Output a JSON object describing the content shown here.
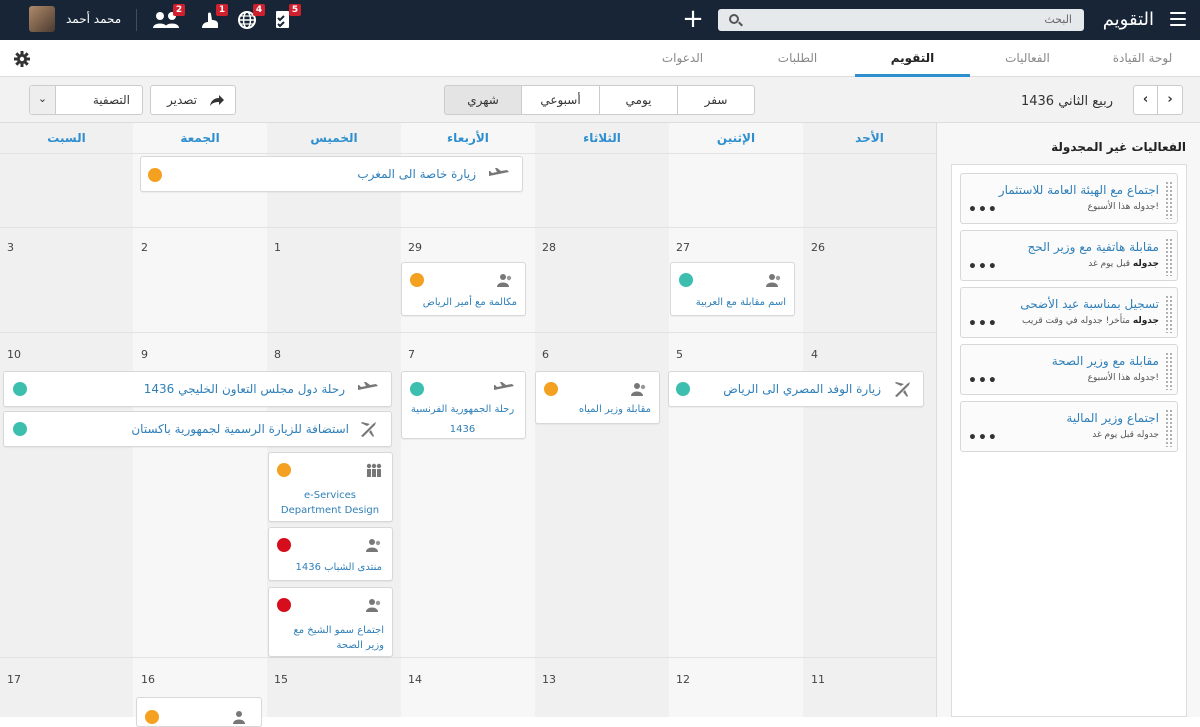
{
  "app": {
    "title": "التقويم",
    "user": "محمد أحمد",
    "search_placeholder": "البحث"
  },
  "notifications": [
    {
      "icon": "group-icon",
      "count": "2"
    },
    {
      "icon": "hand-icon",
      "count": "1"
    },
    {
      "icon": "globe-icon",
      "count": "4"
    },
    {
      "icon": "checklist-icon",
      "count": "5"
    }
  ],
  "tabs": [
    "لوحة القيادة",
    "الفعاليات",
    "التقويم",
    "الطلبات",
    "الدعوات"
  ],
  "active_tab": "التقويم",
  "toolbar": {
    "month": "ربيع الثاني 1436",
    "views": [
      "سفر",
      "يومي",
      "أسبوعي",
      "شهري"
    ],
    "active_view": "شهري",
    "export": "تصدير",
    "filter": "التصفية"
  },
  "weekdays": [
    "الأحد",
    "الإثنين",
    "الثلاثاء",
    "الأربعاء",
    "الخميس",
    "الجمعة",
    "السبت"
  ],
  "weeks": [
    [
      "26",
      "27",
      "28",
      "29",
      "1",
      "2",
      "3"
    ],
    [
      "4",
      "5",
      "6",
      "7",
      "8",
      "9",
      "10"
    ],
    [
      "11",
      "12",
      "13",
      "14",
      "15",
      "16",
      "17"
    ]
  ],
  "events": {
    "morocco_trip": "زيارة خاصة الى المغرب",
    "riyadh_emir_call": "مكالمة مع أمير الرياض",
    "arabiya_interview": "اسم مقابلة مع العربية",
    "egypt_delegation": "زيارة الوفد المصري الى الرياض",
    "water_minister": "مقابلة وزير المياه",
    "french_trip_1": "رحلة الجمهورية الفرنسية",
    "french_trip_2": "1436",
    "gcc_trip": "رحلة دول مجلس التعاون الخليجي 1436",
    "pakistan_visit": "استضافة للزيارة الرسمية لجمهورية باكستان",
    "eservices_1": "e-Services",
    "eservices_2": "Department Design",
    "youth_forum": "منتدى الشباب 1436",
    "health_meeting_1": "اجتماع سمو الشيخ مع",
    "health_meeting_2": "وزير الصحة"
  },
  "unscheduled": {
    "title": "الفعاليات غير المجدولة",
    "items": [
      {
        "title": "اجتماع مع الهيئة العامة للاستثمار",
        "bold": "",
        "rest": "جدوله هذا الأسبوع!"
      },
      {
        "title": "مقابلة هاتفية مع وزير الحج",
        "bold": "جدوله",
        "rest": "قبل يوم غد"
      },
      {
        "title": "تسجيل بمناسبة عيد الأضحى",
        "bold": "جدوله",
        "rest": "متأخر! جدوله في وقت قريب"
      },
      {
        "title": "مقابلة مع وزير الصحة",
        "bold": "",
        "rest": "جدوله هذا الأسبوع!"
      },
      {
        "title": "اجتماع وزير المالية",
        "bold": "",
        "rest": "جدوله قبل يوم غد"
      }
    ]
  },
  "colors": {
    "topbar": "#172536",
    "accent": "#2f8fce",
    "teal": "#3dbfb0",
    "orange": "#f4a020",
    "red": "#d50d1c"
  }
}
